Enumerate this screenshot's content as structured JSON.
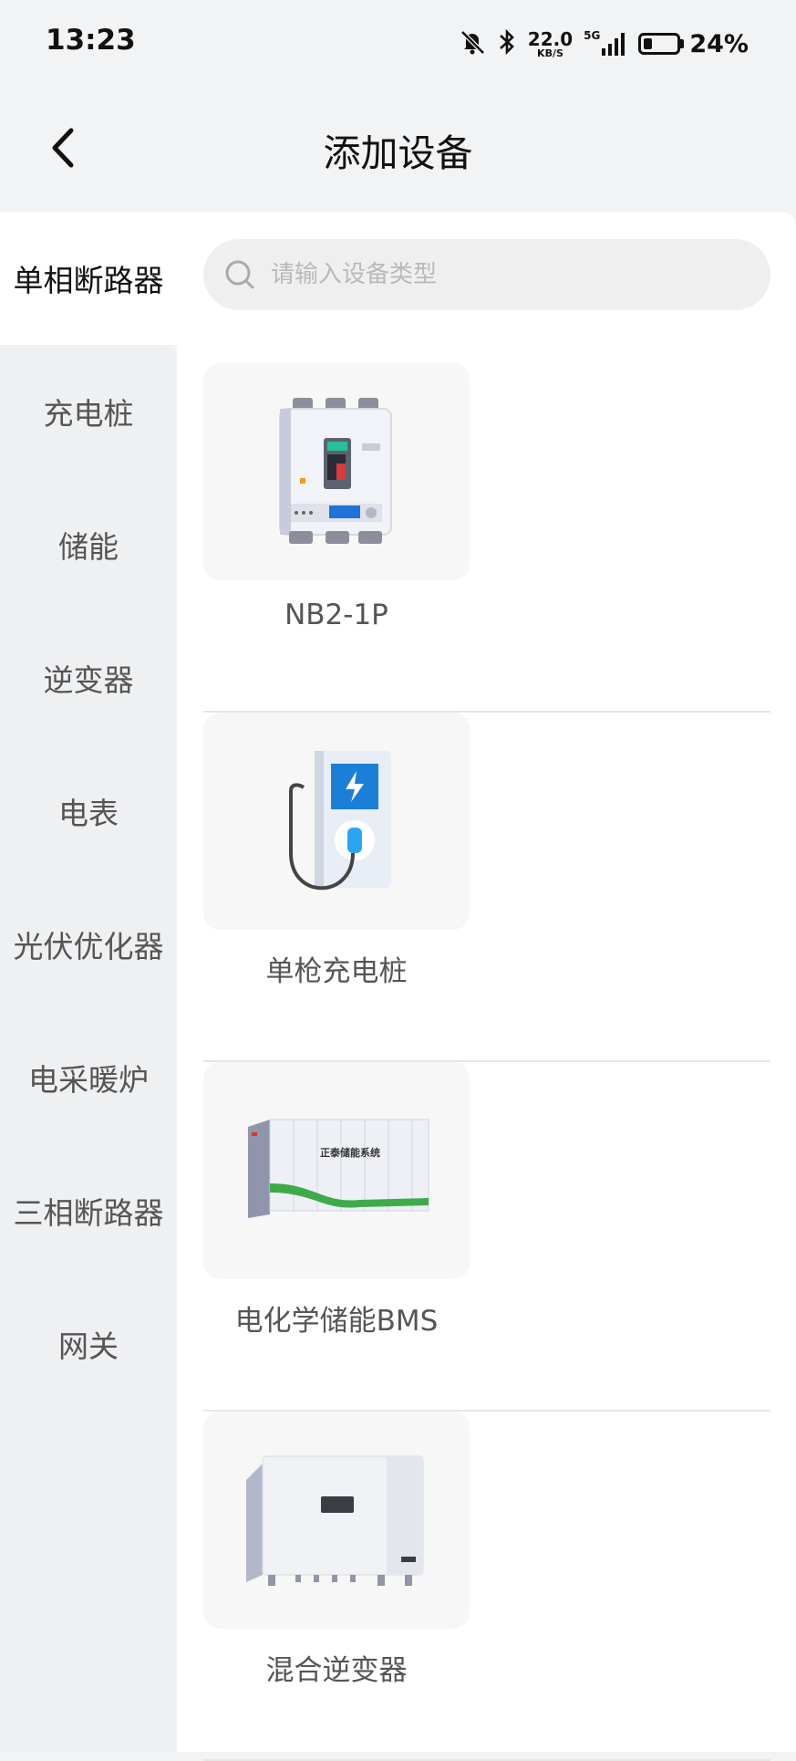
{
  "status_bar": {
    "time": "13:23",
    "net_speed": "22.0",
    "net_unit": "KB/S",
    "signal": "5G",
    "battery": "24%"
  },
  "header": {
    "title": "添加设备"
  },
  "sidebar": {
    "items": [
      {
        "label": "单相断路器",
        "active": true
      },
      {
        "label": "充电桩"
      },
      {
        "label": "储能"
      },
      {
        "label": "逆变器"
      },
      {
        "label": "电表"
      },
      {
        "label": "光伏优化器"
      },
      {
        "label": "电采暖炉"
      },
      {
        "label": "三相断路器"
      },
      {
        "label": "网关"
      }
    ]
  },
  "search": {
    "placeholder": "请输入设备类型"
  },
  "devices": [
    {
      "name": "NB2-1P",
      "icon": "circuit-breaker"
    },
    {
      "name": "单枪充电桩",
      "icon": "ev-charger"
    },
    {
      "name": "电化学储能BMS",
      "icon": "battery-container",
      "label_on_image": "正泰储能系统"
    },
    {
      "name": "混合逆变器",
      "icon": "inverter"
    }
  ]
}
